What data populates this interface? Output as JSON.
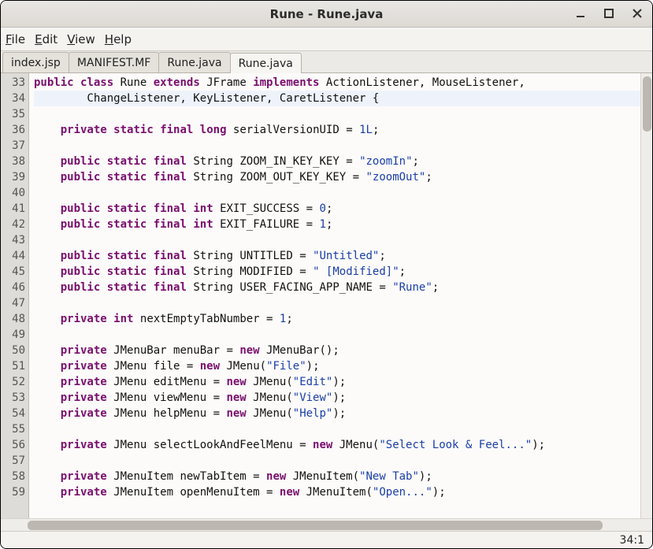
{
  "window": {
    "title": "Rune - Rune.java"
  },
  "menubar": {
    "items": [
      {
        "mn": "F",
        "rest": "ile"
      },
      {
        "mn": "E",
        "rest": "dit"
      },
      {
        "mn": "V",
        "rest": "iew"
      },
      {
        "mn": "H",
        "rest": "elp"
      }
    ]
  },
  "tabs": [
    {
      "label": "index.jsp",
      "active": false
    },
    {
      "label": "MANIFEST.MF",
      "active": false
    },
    {
      "label": "Rune.java",
      "active": false
    },
    {
      "label": "Rune.java",
      "active": true
    }
  ],
  "editor": {
    "first_line": 33,
    "caret_line": 34,
    "lines": [
      {
        "n": 33,
        "tokens": [
          [
            "kw",
            "public"
          ],
          [
            "p",
            " "
          ],
          [
            "kw",
            "class"
          ],
          [
            "p",
            " Rune "
          ],
          [
            "kw",
            "extends"
          ],
          [
            "p",
            " JFrame "
          ],
          [
            "kw",
            "implements"
          ],
          [
            "p",
            " ActionListener, MouseListener,"
          ]
        ]
      },
      {
        "n": 34,
        "caret": true,
        "tokens": [
          [
            "p",
            "        ChangeListener, KeyListener, CaretListener {"
          ]
        ]
      },
      {
        "n": 35,
        "tokens": []
      },
      {
        "n": 36,
        "tokens": [
          [
            "p",
            "    "
          ],
          [
            "kw",
            "private"
          ],
          [
            "p",
            " "
          ],
          [
            "kw",
            "static"
          ],
          [
            "p",
            " "
          ],
          [
            "kw",
            "final"
          ],
          [
            "p",
            " "
          ],
          [
            "tp",
            "long"
          ],
          [
            "p",
            " serialVersionUID = "
          ],
          [
            "num",
            "1L"
          ],
          [
            "p",
            ";"
          ]
        ]
      },
      {
        "n": 37,
        "tokens": []
      },
      {
        "n": 38,
        "tokens": [
          [
            "p",
            "    "
          ],
          [
            "kw",
            "public"
          ],
          [
            "p",
            " "
          ],
          [
            "kw",
            "static"
          ],
          [
            "p",
            " "
          ],
          [
            "kw",
            "final"
          ],
          [
            "p",
            " String ZOOM_IN_KEY_KEY = "
          ],
          [
            "str",
            "\"zoomIn\""
          ],
          [
            "p",
            ";"
          ]
        ]
      },
      {
        "n": 39,
        "tokens": [
          [
            "p",
            "    "
          ],
          [
            "kw",
            "public"
          ],
          [
            "p",
            " "
          ],
          [
            "kw",
            "static"
          ],
          [
            "p",
            " "
          ],
          [
            "kw",
            "final"
          ],
          [
            "p",
            " String ZOOM_OUT_KEY_KEY = "
          ],
          [
            "str",
            "\"zoomOut\""
          ],
          [
            "p",
            ";"
          ]
        ]
      },
      {
        "n": 40,
        "tokens": []
      },
      {
        "n": 41,
        "tokens": [
          [
            "p",
            "    "
          ],
          [
            "kw",
            "public"
          ],
          [
            "p",
            " "
          ],
          [
            "kw",
            "static"
          ],
          [
            "p",
            " "
          ],
          [
            "kw",
            "final"
          ],
          [
            "p",
            " "
          ],
          [
            "tp",
            "int"
          ],
          [
            "p",
            " EXIT_SUCCESS = "
          ],
          [
            "num",
            "0"
          ],
          [
            "p",
            ";"
          ]
        ]
      },
      {
        "n": 42,
        "tokens": [
          [
            "p",
            "    "
          ],
          [
            "kw",
            "public"
          ],
          [
            "p",
            " "
          ],
          [
            "kw",
            "static"
          ],
          [
            "p",
            " "
          ],
          [
            "kw",
            "final"
          ],
          [
            "p",
            " "
          ],
          [
            "tp",
            "int"
          ],
          [
            "p",
            " EXIT_FAILURE = "
          ],
          [
            "num",
            "1"
          ],
          [
            "p",
            ";"
          ]
        ]
      },
      {
        "n": 43,
        "tokens": []
      },
      {
        "n": 44,
        "tokens": [
          [
            "p",
            "    "
          ],
          [
            "kw",
            "public"
          ],
          [
            "p",
            " "
          ],
          [
            "kw",
            "static"
          ],
          [
            "p",
            " "
          ],
          [
            "kw",
            "final"
          ],
          [
            "p",
            " String UNTITLED = "
          ],
          [
            "str",
            "\"Untitled\""
          ],
          [
            "p",
            ";"
          ]
        ]
      },
      {
        "n": 45,
        "tokens": [
          [
            "p",
            "    "
          ],
          [
            "kw",
            "public"
          ],
          [
            "p",
            " "
          ],
          [
            "kw",
            "static"
          ],
          [
            "p",
            " "
          ],
          [
            "kw",
            "final"
          ],
          [
            "p",
            " String MODIFIED = "
          ],
          [
            "str",
            "\" [Modified]\""
          ],
          [
            "p",
            ";"
          ]
        ]
      },
      {
        "n": 46,
        "tokens": [
          [
            "p",
            "    "
          ],
          [
            "kw",
            "public"
          ],
          [
            "p",
            " "
          ],
          [
            "kw",
            "static"
          ],
          [
            "p",
            " "
          ],
          [
            "kw",
            "final"
          ],
          [
            "p",
            " String USER_FACING_APP_NAME = "
          ],
          [
            "str",
            "\"Rune\""
          ],
          [
            "p",
            ";"
          ]
        ]
      },
      {
        "n": 47,
        "tokens": []
      },
      {
        "n": 48,
        "tokens": [
          [
            "p",
            "    "
          ],
          [
            "kw",
            "private"
          ],
          [
            "p",
            " "
          ],
          [
            "tp",
            "int"
          ],
          [
            "p",
            " nextEmptyTabNumber = "
          ],
          [
            "num",
            "1"
          ],
          [
            "p",
            ";"
          ]
        ]
      },
      {
        "n": 49,
        "tokens": []
      },
      {
        "n": 50,
        "tokens": [
          [
            "p",
            "    "
          ],
          [
            "kw",
            "private"
          ],
          [
            "p",
            " JMenuBar menuBar = "
          ],
          [
            "kw",
            "new"
          ],
          [
            "p",
            " JMenuBar();"
          ]
        ]
      },
      {
        "n": 51,
        "tokens": [
          [
            "p",
            "    "
          ],
          [
            "kw",
            "private"
          ],
          [
            "p",
            " JMenu file = "
          ],
          [
            "kw",
            "new"
          ],
          [
            "p",
            " JMenu("
          ],
          [
            "str",
            "\"File\""
          ],
          [
            "p",
            ");"
          ]
        ]
      },
      {
        "n": 52,
        "tokens": [
          [
            "p",
            "    "
          ],
          [
            "kw",
            "private"
          ],
          [
            "p",
            " JMenu editMenu = "
          ],
          [
            "kw",
            "new"
          ],
          [
            "p",
            " JMenu("
          ],
          [
            "str",
            "\"Edit\""
          ],
          [
            "p",
            ");"
          ]
        ]
      },
      {
        "n": 53,
        "tokens": [
          [
            "p",
            "    "
          ],
          [
            "kw",
            "private"
          ],
          [
            "p",
            " JMenu viewMenu = "
          ],
          [
            "kw",
            "new"
          ],
          [
            "p",
            " JMenu("
          ],
          [
            "str",
            "\"View\""
          ],
          [
            "p",
            ");"
          ]
        ]
      },
      {
        "n": 54,
        "tokens": [
          [
            "p",
            "    "
          ],
          [
            "kw",
            "private"
          ],
          [
            "p",
            " JMenu helpMenu = "
          ],
          [
            "kw",
            "new"
          ],
          [
            "p",
            " JMenu("
          ],
          [
            "str",
            "\"Help\""
          ],
          [
            "p",
            ");"
          ]
        ]
      },
      {
        "n": 55,
        "tokens": []
      },
      {
        "n": 56,
        "tokens": [
          [
            "p",
            "    "
          ],
          [
            "kw",
            "private"
          ],
          [
            "p",
            " JMenu selectLookAndFeelMenu = "
          ],
          [
            "kw",
            "new"
          ],
          [
            "p",
            " JMenu("
          ],
          [
            "str",
            "\"Select Look & Feel...\""
          ],
          [
            "p",
            ");"
          ]
        ]
      },
      {
        "n": 57,
        "tokens": []
      },
      {
        "n": 58,
        "tokens": [
          [
            "p",
            "    "
          ],
          [
            "kw",
            "private"
          ],
          [
            "p",
            " JMenuItem newTabItem = "
          ],
          [
            "kw",
            "new"
          ],
          [
            "p",
            " JMenuItem("
          ],
          [
            "str",
            "\"New Tab\""
          ],
          [
            "p",
            ");"
          ]
        ]
      },
      {
        "n": 59,
        "tokens": [
          [
            "p",
            "    "
          ],
          [
            "kw",
            "private"
          ],
          [
            "p",
            " JMenuItem openMenuItem = "
          ],
          [
            "kw",
            "new"
          ],
          [
            "p",
            " JMenuItem("
          ],
          [
            "str",
            "\"Open...\""
          ],
          [
            "p",
            ");"
          ]
        ]
      }
    ]
  },
  "status": {
    "position": "34:1"
  }
}
